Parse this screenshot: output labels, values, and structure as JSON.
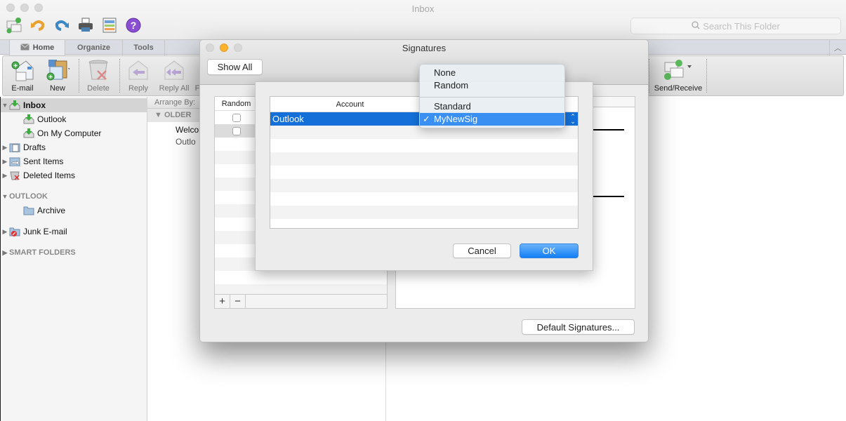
{
  "main_window": {
    "title": "Inbox",
    "search_placeholder": "Search This Folder",
    "quick_access": [
      "send-receive-icon",
      "undo-icon",
      "redo-icon",
      "print-icon",
      "view-icon",
      "help-icon"
    ],
    "ribbon_tabs": [
      {
        "label": "Home",
        "active": true
      },
      {
        "label": "Organize",
        "active": false
      },
      {
        "label": "Tools",
        "active": false
      }
    ],
    "ribbon_buttons": {
      "email": "E-mail",
      "new": "New",
      "delete": "Delete",
      "reply": "Reply",
      "reply_all": "Reply All",
      "forward_partial": "F",
      "send_receive": "Send/Receive"
    }
  },
  "sidebar": {
    "inbox": "Inbox",
    "inbox_children": [
      "Outlook",
      "On My Computer"
    ],
    "drafts": "Drafts",
    "sent": "Sent Items",
    "deleted": "Deleted Items",
    "section_outlook": "OUTLOOK",
    "archive": "Archive",
    "junk": "Junk E-mail",
    "section_smart": "SMART FOLDERS"
  },
  "message_list": {
    "arrange_by": "Arrange By:",
    "group": "OLDER",
    "messages": [
      {
        "sender": "Welco",
        "subject": "Outlo"
      }
    ]
  },
  "signatures_window": {
    "title": "Signatures",
    "show_all": "Show All",
    "list_header": "Random",
    "add": "+",
    "remove": "−",
    "default_signatures": "Default Signatures..."
  },
  "account_sheet": {
    "column_account": "Account",
    "rows": [
      {
        "account": "Outlook",
        "signature": "MyNewSig"
      }
    ],
    "cancel": "Cancel",
    "ok": "OK"
  },
  "signature_popup": {
    "options": [
      {
        "label": "None",
        "checked": false
      },
      {
        "label": "Random",
        "checked": false
      },
      {
        "label": "Standard",
        "checked": false
      },
      {
        "label": "MyNewSig",
        "checked": true
      }
    ],
    "check_glyph": "✓"
  },
  "colors": {
    "selection_blue": "#1470d8",
    "menu_highlight": "#3a8ff2",
    "primary_button": "#127ff5"
  }
}
